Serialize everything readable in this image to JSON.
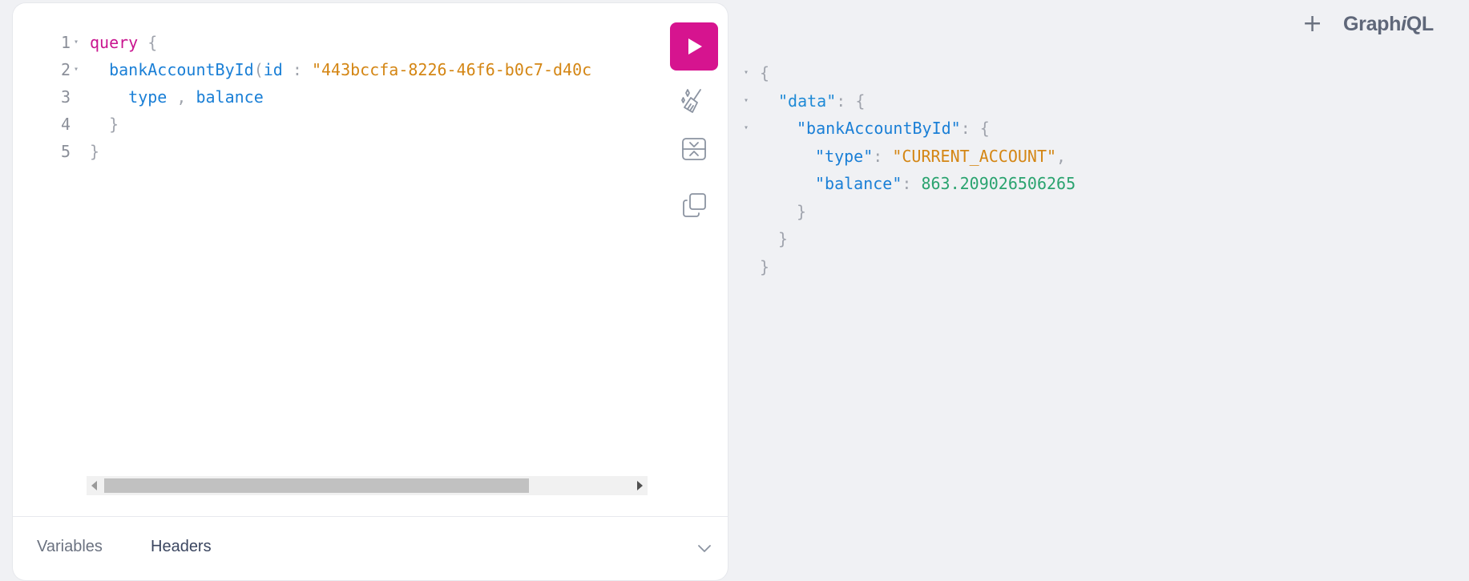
{
  "app": {
    "logo_prefix": "Graph",
    "logo_italic": "i",
    "logo_suffix": "QL",
    "add_tab": "+"
  },
  "editor": {
    "lines": [
      {
        "num": "1",
        "fold": "▾",
        "tokens": [
          [
            "kw",
            "query"
          ],
          [
            "punct",
            " {"
          ]
        ]
      },
      {
        "num": "2",
        "fold": "▾",
        "tokens": [
          [
            "fn",
            "  bankAccountById"
          ],
          [
            "punct",
            "("
          ],
          [
            "arg",
            "id"
          ],
          [
            "punct",
            " : "
          ],
          [
            "str",
            "\"443bccfa-8226-46f6-b0c7-d40c"
          ]
        ]
      },
      {
        "num": "3",
        "fold": "",
        "tokens": [
          [
            "field",
            "    type"
          ],
          [
            "punct",
            " , "
          ],
          [
            "field",
            "balance"
          ]
        ]
      },
      {
        "num": "4",
        "fold": "",
        "tokens": [
          [
            "punct",
            "  }"
          ]
        ]
      },
      {
        "num": "5",
        "fold": "",
        "tokens": [
          [
            "punct",
            "}"
          ]
        ]
      }
    ]
  },
  "tools": {
    "run": "run-icon",
    "prettify": "prettify-icon",
    "merge": "merge-fragments-icon",
    "copy": "copy-icon"
  },
  "bottom_tabs": {
    "variables": "Variables",
    "headers": "Headers"
  },
  "result": {
    "lines": [
      {
        "fold": "▾",
        "indent": 0,
        "tokens": [
          [
            "punct",
            "{"
          ]
        ]
      },
      {
        "fold": "▾",
        "indent": 1,
        "tokens": [
          [
            "key",
            "\"data\""
          ],
          [
            "punct",
            ": {"
          ]
        ]
      },
      {
        "fold": "▾",
        "indent": 2,
        "tokens": [
          [
            "key2",
            "\"bankAccountById\""
          ],
          [
            "punct",
            ": {"
          ]
        ]
      },
      {
        "fold": "",
        "indent": 3,
        "tokens": [
          [
            "key2",
            "\"type\""
          ],
          [
            "punct",
            ": "
          ],
          [
            "rstr",
            "\"CURRENT_ACCOUNT\""
          ],
          [
            "punct",
            ","
          ]
        ]
      },
      {
        "fold": "",
        "indent": 3,
        "tokens": [
          [
            "key2",
            "\"balance\""
          ],
          [
            "punct",
            ": "
          ],
          [
            "num",
            "863.209026506265"
          ]
        ]
      },
      {
        "fold": "",
        "indent": 2,
        "tokens": [
          [
            "punct",
            "}"
          ]
        ]
      },
      {
        "fold": "",
        "indent": 1,
        "tokens": [
          [
            "punct",
            "}"
          ]
        ]
      },
      {
        "fold": "",
        "indent": 0,
        "tokens": [
          [
            "punct",
            "}"
          ]
        ]
      }
    ]
  },
  "colors": {
    "accent": "#d6148f",
    "background": "#f0f1f4"
  }
}
